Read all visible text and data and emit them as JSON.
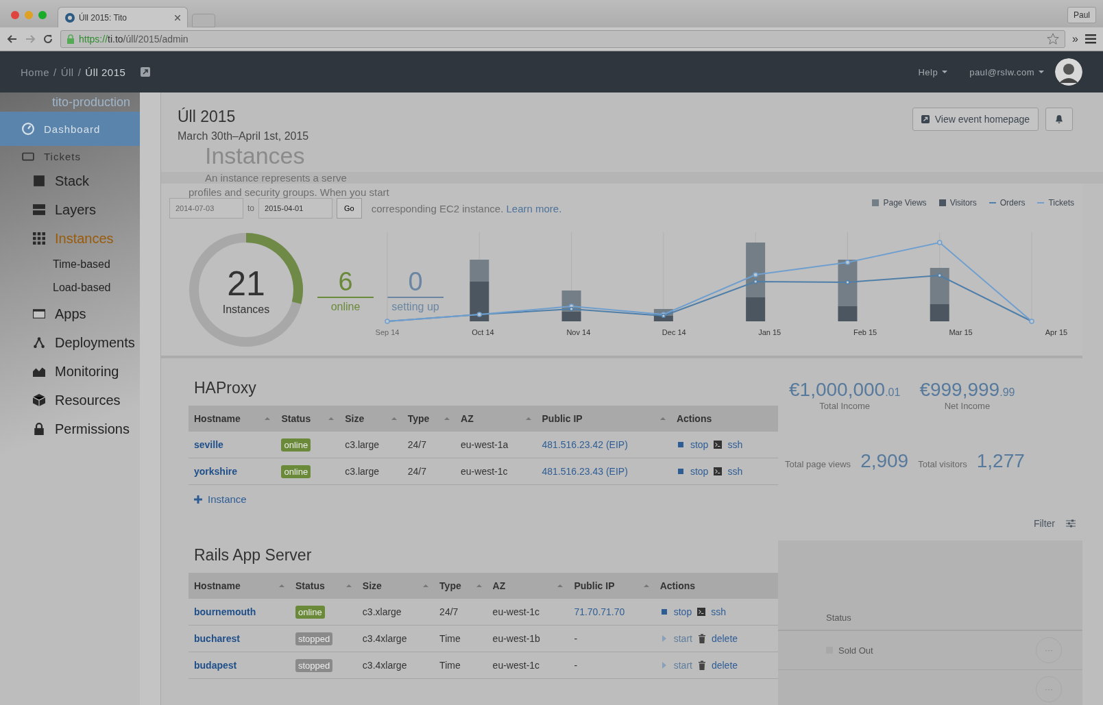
{
  "browser": {
    "tab_title": "Úll 2015: Tito",
    "url_scheme": "https://",
    "url_host": "ti.to",
    "url_path": "/úll/2015/admin",
    "profile": "Paul",
    "overflow": "»"
  },
  "topbar": {
    "breadcrumbs": [
      {
        "label": "Home",
        "current": false
      },
      {
        "label": "Úll",
        "current": false
      },
      {
        "label": "Úll 2015",
        "current": true
      }
    ],
    "separator": "/",
    "menus": [
      "Help",
      "paul@rslw.com"
    ]
  },
  "sidebar": {
    "account": "tito-production",
    "items": [
      {
        "label": "Dashboard",
        "kind": "ghost",
        "selected": true
      },
      {
        "label": "Tickets",
        "kind": "ghost",
        "selected": false
      },
      {
        "label": "Stack",
        "kind": "main",
        "selected": false
      },
      {
        "label": "Layers",
        "kind": "main",
        "selected": false
      },
      {
        "label": "Instances",
        "kind": "main",
        "selected": true
      },
      {
        "label": "Time-based",
        "kind": "sub",
        "selected": false
      },
      {
        "label": "Load-based",
        "kind": "sub",
        "selected": false
      },
      {
        "label": "Apps",
        "kind": "main",
        "selected": false
      },
      {
        "label": "Deployments",
        "kind": "main",
        "selected": false
      },
      {
        "label": "Monitoring",
        "kind": "main",
        "selected": false
      },
      {
        "label": "Resources",
        "kind": "main",
        "selected": false
      },
      {
        "label": "Permissions",
        "kind": "main",
        "selected": false
      }
    ]
  },
  "header": {
    "title": "Úll 2015",
    "dates": "March 30th–April 1st, 2015",
    "ghost_title": "Instances",
    "button": "View event homepage"
  },
  "band": {
    "description": [
      "An instance represents a serve",
      "profiles and security groups. When you start",
      "corresponding EC2 instance."
    ],
    "learn_more": "Learn more.",
    "date_from": "2014-07-03",
    "to": "to",
    "date_to": "2015-04-01",
    "go": "Go",
    "legend": [
      {
        "label": "Page Views",
        "kind": "bar",
        "color": "#737e86"
      },
      {
        "label": "Visitors",
        "kind": "bar",
        "color": "#4b5660"
      },
      {
        "label": "Orders",
        "kind": "line",
        "color": "#4f7fa8"
      },
      {
        "label": "Tickets",
        "kind": "line",
        "color": "#6f9fcf"
      }
    ]
  },
  "summary": {
    "total": "21",
    "label": "Instances",
    "stats": [
      {
        "value": "6",
        "label": "online",
        "color": "#6a8a3a"
      },
      {
        "value": "0",
        "label": "setting up",
        "color": "#6a86a3"
      }
    ]
  },
  "chart_x_labels": [
    "Sep 14",
    "Oct 14",
    "Nov 14",
    "Dec 14",
    "Jan 15",
    "Feb 15",
    "Mar 15",
    "Apr 15"
  ],
  "income": [
    {
      "whole": "€1,000,000",
      "cents": ".01",
      "label": "Total Income"
    },
    {
      "whole": "€999,999",
      "cents": ".99",
      "label": "Net Income"
    }
  ],
  "traffic": [
    {
      "label": "Total page views",
      "value": "2,909"
    },
    {
      "label": "Total visitors",
      "value": "1,277"
    }
  ],
  "filter": "Filter",
  "tickets_table": {
    "column": "Status",
    "rows": [
      {
        "label": "Sold Out",
        "menu": "···"
      },
      {
        "menu": "···"
      }
    ]
  },
  "layers": [
    {
      "title": "HAProxy",
      "add": "Instance",
      "columns": [
        {
          "label": "Hostname",
          "sortable": true
        },
        {
          "label": "Status",
          "sortable": true
        },
        {
          "label": "Size",
          "sortable": true
        },
        {
          "label": "Type",
          "sortable": true
        },
        {
          "label": "AZ",
          "sortable": true
        },
        {
          "label": "Public IP",
          "sortable": true
        },
        {
          "label": "Actions",
          "sortable": false
        }
      ],
      "rows": [
        {
          "hostname": "seville",
          "status": "online",
          "color": "#6a8a3a",
          "size": "c3.large",
          "type": "24/7",
          "az": "eu-west-1a",
          "ip": "481.516.23.42 (EIP)",
          "ip_linked": true,
          "actions": [
            {
              "kind": "stop",
              "label": "stop",
              "disabled": false
            },
            {
              "kind": "ssh",
              "label": "ssh",
              "disabled": false
            }
          ]
        },
        {
          "hostname": "yorkshire",
          "status": "online",
          "color": "#6a8a3a",
          "size": "c3.large",
          "type": "24/7",
          "az": "eu-west-1c",
          "ip": "481.516.23.43 (EIP)",
          "ip_linked": true,
          "actions": [
            {
              "kind": "stop",
              "label": "stop",
              "disabled": false
            },
            {
              "kind": "ssh",
              "label": "ssh",
              "disabled": false
            }
          ]
        }
      ]
    },
    {
      "title": "Rails App Server",
      "columns": [
        {
          "label": "Hostname",
          "sortable": true
        },
        {
          "label": "Status",
          "sortable": true
        },
        {
          "label": "Size",
          "sortable": true
        },
        {
          "label": "Type",
          "sortable": true
        },
        {
          "label": "AZ",
          "sortable": true
        },
        {
          "label": "Public IP",
          "sortable": true
        },
        {
          "label": "Actions",
          "sortable": false
        }
      ],
      "rows": [
        {
          "hostname": "bournemouth",
          "status": "online",
          "color": "#6a8a3a",
          "size": "c3.xlarge",
          "type": "24/7",
          "az": "eu-west-1c",
          "ip": "71.70.71.70",
          "ip_linked": true,
          "actions": [
            {
              "kind": "stop",
              "label": "stop",
              "disabled": false
            },
            {
              "kind": "ssh",
              "label": "ssh",
              "disabled": false
            }
          ]
        },
        {
          "hostname": "bucharest",
          "status": "stopped",
          "color": "#8a8a8a",
          "size": "c3.4xlarge",
          "type": "Time",
          "az": "eu-west-1b",
          "ip": "-",
          "ip_linked": false,
          "actions": [
            {
              "kind": "start",
              "label": "start",
              "disabled": true
            },
            {
              "kind": "delete",
              "label": "delete",
              "disabled": false
            }
          ]
        },
        {
          "hostname": "budapest",
          "status": "stopped",
          "color": "#8a8a8a",
          "size": "c3.4xlarge",
          "type": "Time",
          "az": "eu-west-1c",
          "ip": "-",
          "ip_linked": false,
          "actions": [
            {
              "kind": "start",
              "label": "start",
              "disabled": true
            },
            {
              "kind": "delete",
              "label": "delete",
              "disabled": false
            }
          ]
        }
      ]
    }
  ]
}
